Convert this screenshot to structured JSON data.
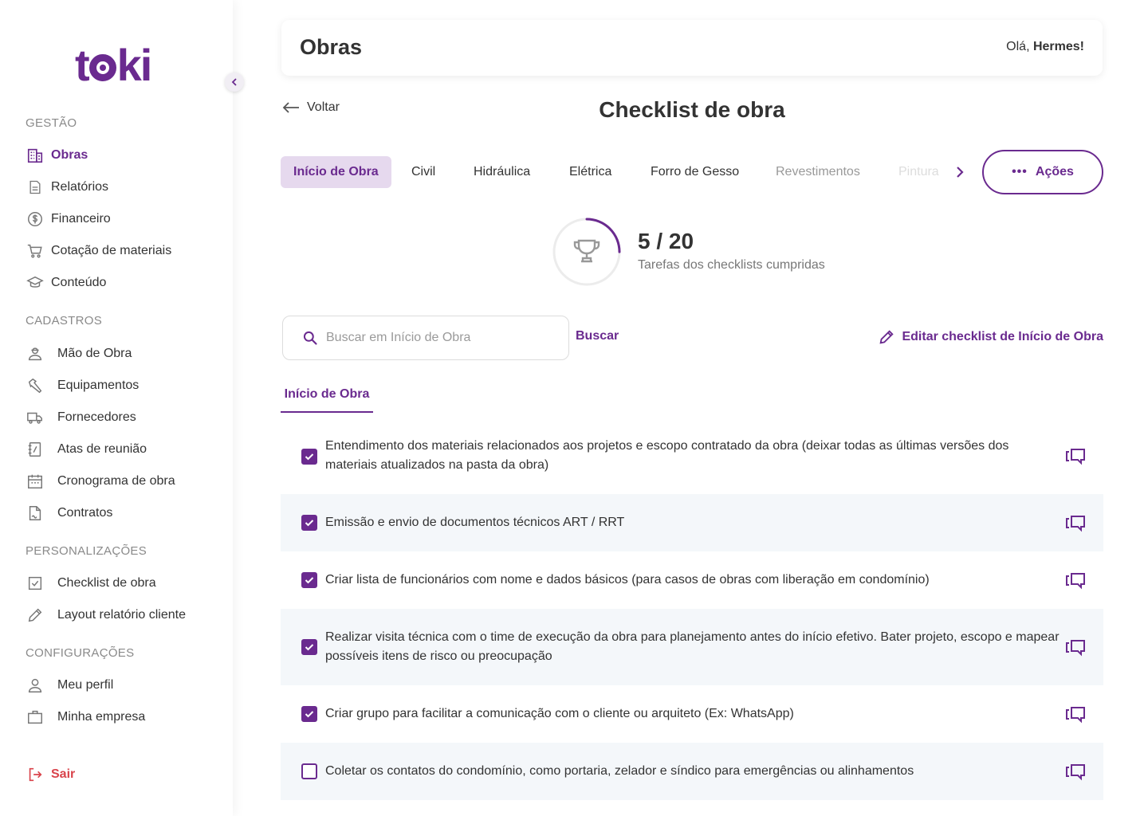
{
  "app": {
    "logo_text": "toki",
    "user_greeting_prefix": "Olá,",
    "user_name": "Hermes!"
  },
  "sidebar": {
    "sections": [
      {
        "title": "GESTÃO"
      },
      {
        "title": "CADASTROS"
      },
      {
        "title": "PERSONALIZAÇÕES"
      },
      {
        "title": "CONFIGURAÇÕES"
      }
    ],
    "gestao": [
      {
        "label": "Obras",
        "icon": "building-icon",
        "active": true
      },
      {
        "label": "Relatórios",
        "icon": "document-icon"
      },
      {
        "label": "Financeiro",
        "icon": "dollar-icon"
      },
      {
        "label": "Cotação de materiais",
        "icon": "cart-icon"
      },
      {
        "label": "Conteúdo",
        "icon": "graduation-cap-icon"
      }
    ],
    "cadastros": [
      {
        "label": "Mão de Obra",
        "icon": "worker-icon"
      },
      {
        "label": "Equipamentos",
        "icon": "hammer-icon"
      },
      {
        "label": "Fornecedores",
        "icon": "truck-icon"
      },
      {
        "label": "Atas de reunião",
        "icon": "notebook-icon"
      },
      {
        "label": "Cronograma de obra",
        "icon": "calendar-icon"
      },
      {
        "label": "Contratos",
        "icon": "contract-icon"
      }
    ],
    "personalizacoes": [
      {
        "label": "Checklist de obra",
        "icon": "checkbox-icon"
      },
      {
        "label": "Layout relatório cliente",
        "icon": "pencil-icon"
      }
    ],
    "configuracoes": [
      {
        "label": "Meu perfil",
        "icon": "user-icon"
      },
      {
        "label": "Minha empresa",
        "icon": "briefcase-icon"
      }
    ],
    "logout": "Sair"
  },
  "header": {
    "title": "Obras"
  },
  "page": {
    "back_label": "Voltar",
    "title": "Checklist de obra"
  },
  "tabs": [
    {
      "label": "Início de Obra",
      "active": true
    },
    {
      "label": "Civil"
    },
    {
      "label": "Hidráulica"
    },
    {
      "label": "Elétrica"
    },
    {
      "label": "Forro de Gesso"
    },
    {
      "label": "Revestimentos"
    },
    {
      "label": "Pintura"
    }
  ],
  "actions_label": "Ações",
  "progress": {
    "done": 5,
    "total": 20,
    "count_text": "5 / 20",
    "label": "Tarefas dos checklists cumpridas"
  },
  "search": {
    "placeholder": "Buscar em Início de Obra",
    "button": "Buscar"
  },
  "edit_label": "Editar checklist de Início de Obra",
  "section_tab": "Início de Obra",
  "checklist": [
    {
      "text": "Entendimento dos materiais relacionados aos projetos e escopo contratado da obra (deixar todas as últimas versões dos materiais atualizados na pasta da obra)",
      "checked": true
    },
    {
      "text": "Emissão e envio de documentos técnicos ART / RRT",
      "checked": true
    },
    {
      "text": "Criar lista de funcionários com nome e dados básicos (para casos de obras com liberação em condomínio)",
      "checked": true
    },
    {
      "text": "Realizar visita técnica com o time de execução da obra para planejamento antes do início efetivo. Bater projeto, escopo e mapear possíveis itens de risco ou preocupação",
      "checked": true
    },
    {
      "text": "Criar grupo para facilitar a comunicação com o cliente ou arquiteto (Ex: WhatsApp)",
      "checked": true
    },
    {
      "text": "Coletar os contatos do condomínio, como portaria, zelador e síndico para emergências ou alinhamentos",
      "checked": false
    }
  ],
  "colors": {
    "brand": "#6a2a8f",
    "tab_active_bg": "#e6d9ee",
    "row_alt_bg": "#f4f7fa",
    "logout": "#d9434b"
  }
}
